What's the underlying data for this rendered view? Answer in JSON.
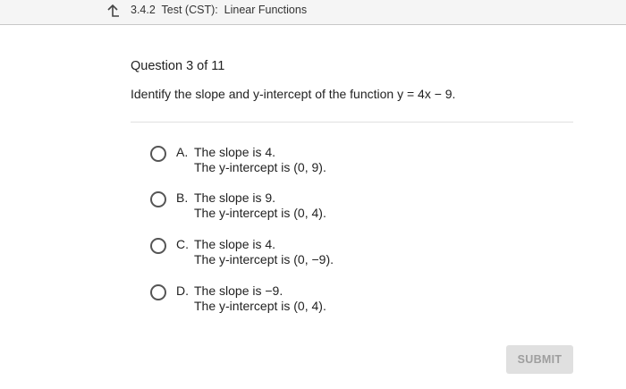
{
  "header": {
    "breadcrumb": "3.4.2  Test (CST):  Linear Functions",
    "back_icon": "return-arrow-icon"
  },
  "question": {
    "progress": "Question 3 of 11",
    "prompt": "Identify the slope and y-intercept of the function y = 4x − 9."
  },
  "choices": [
    {
      "letter": "A.",
      "line1": "The slope is 4.",
      "line2": "The y-intercept is (0, 9)."
    },
    {
      "letter": "B.",
      "line1": "The slope is 9.",
      "line2": "The y-intercept is (0, 4)."
    },
    {
      "letter": "C.",
      "line1": "The slope is 4.",
      "line2": "The y-intercept is (0, −9)."
    },
    {
      "letter": "D.",
      "line1": "The slope is −9.",
      "line2": "The y-intercept is (0, 4)."
    }
  ],
  "footer": {
    "submit_label": "SUBMIT"
  },
  "colors": {
    "topbar_bg": "#f5f5f5",
    "submit_bg": "#e0e0e0",
    "submit_text": "#9e9e9e"
  }
}
